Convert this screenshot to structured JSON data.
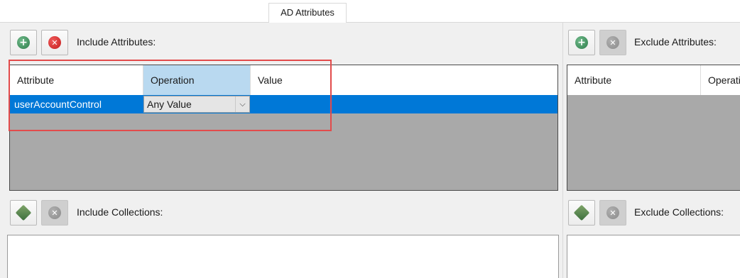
{
  "tab": {
    "label": "AD Attributes"
  },
  "include_attributes": {
    "label": "Include Attributes:",
    "add_icon": "add-icon",
    "remove_icon": "remove-icon",
    "columns": [
      "Attribute",
      "Operation",
      "Value"
    ],
    "rows": [
      {
        "attribute": "userAccountControl",
        "operation": "Any Value",
        "value": ""
      }
    ]
  },
  "exclude_attributes": {
    "label": "Exclude Attributes:",
    "columns": [
      "Attribute",
      "Operati"
    ]
  },
  "include_collections": {
    "label": "Include Collections:"
  },
  "exclude_collections": {
    "label": "Exclude Collections:"
  },
  "colors": {
    "selection": "#0078d7",
    "highlight": "#e24b4b",
    "selected_header": "#b9d9f0",
    "grid_background": "#a9a9a9"
  },
  "glyphs": {
    "plus": "+",
    "x": "✕",
    "chevron": "⌵"
  }
}
